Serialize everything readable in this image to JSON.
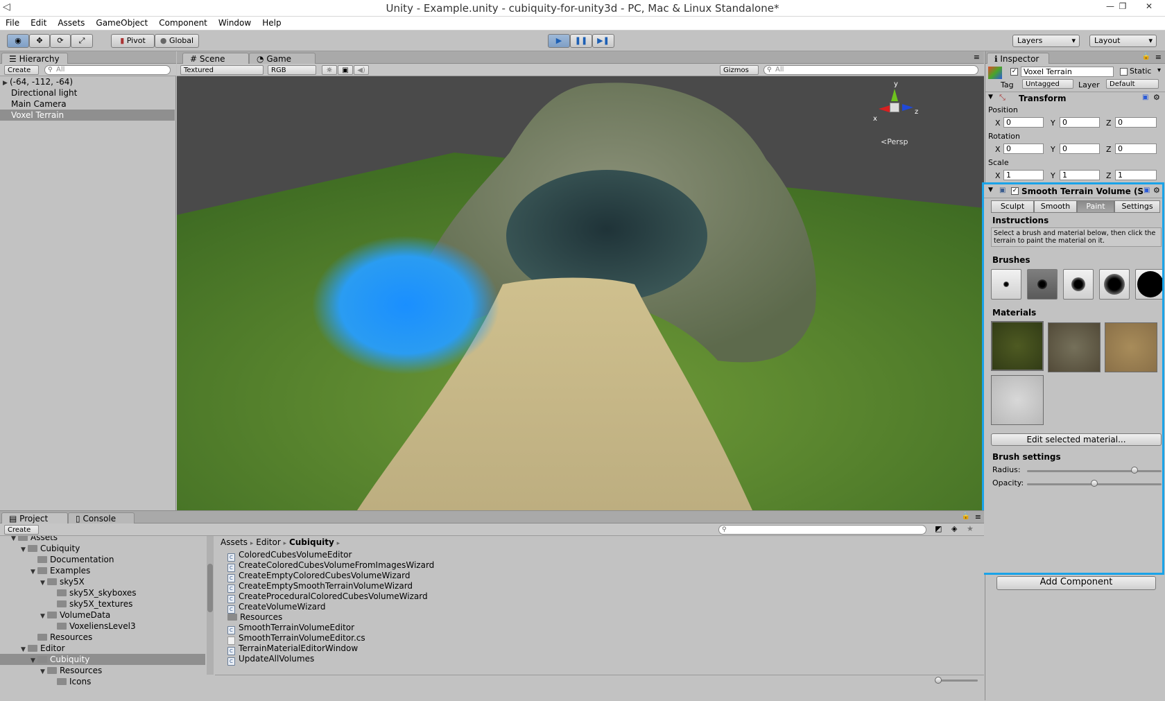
{
  "window": {
    "title": "Unity - Example.unity - cubiquity-for-unity3d - PC, Mac & Linux Standalone*"
  },
  "menu": [
    "File",
    "Edit",
    "Assets",
    "GameObject",
    "Component",
    "Window",
    "Help"
  ],
  "toolbar": {
    "pivot": "Pivot",
    "global": "Global",
    "layers": "Layers",
    "layout": "Layout"
  },
  "hierarchy": {
    "tab": "Hierarchy",
    "create": "Create",
    "search_placeholder": "All",
    "items": [
      "(-64, -112, -64)",
      "Directional light",
      "Main Camera",
      "Voxel Terrain"
    ]
  },
  "scene": {
    "tab_scene": "Scene",
    "tab_game": "Game",
    "render_mode": "Textured",
    "color_mode": "RGB",
    "gizmos": "Gizmos",
    "search_placeholder": "All",
    "persp": "Persp",
    "axis_y": "y",
    "axis_x": "x",
    "axis_z": "z"
  },
  "inspector": {
    "tab": "Inspector",
    "object_name": "Voxel Terrain",
    "static": "Static",
    "tag_label": "Tag",
    "tag_value": "Untagged",
    "layer_label": "Layer",
    "layer_value": "Default",
    "transform": {
      "title": "Transform",
      "position": {
        "label": "Position",
        "x": "0",
        "y": "0",
        "z": "0"
      },
      "rotation": {
        "label": "Rotation",
        "x": "0",
        "y": "0",
        "z": "0"
      },
      "scale": {
        "label": "Scale",
        "x": "1",
        "y": "1",
        "z": "1"
      },
      "x": "X",
      "y": "Y",
      "z": "Z"
    },
    "component": {
      "title": "Smooth Terrain Volume (S",
      "tabs": [
        "Sculpt",
        "Smooth",
        "Paint",
        "Settings"
      ],
      "instructions_title": "Instructions",
      "instructions_line1": "Select a brush and material below, then click the",
      "instructions_line2": "terrain to paint the material on it.",
      "brushes_title": "Brushes",
      "materials_title": "Materials",
      "edit_material": "Edit selected material...",
      "brush_settings_title": "Brush settings",
      "radius_label": "Radius:",
      "radius_value": 0.8,
      "opacity_label": "Opacity:",
      "opacity_value": 0.5
    },
    "add_component": "Add Component"
  },
  "project": {
    "tab_project": "Project",
    "tab_console": "Console",
    "create": "Create",
    "tree": [
      {
        "label": "Assets",
        "depth": 0
      },
      {
        "label": "Cubiquity",
        "depth": 1
      },
      {
        "label": "Documentation",
        "depth": 2
      },
      {
        "label": "Examples",
        "depth": 2
      },
      {
        "label": "sky5X",
        "depth": 3
      },
      {
        "label": "sky5X_skyboxes",
        "depth": 4
      },
      {
        "label": "sky5X_textures",
        "depth": 4
      },
      {
        "label": "VolumeData",
        "depth": 3
      },
      {
        "label": "VoxeliensLevel3",
        "depth": 4
      },
      {
        "label": "Resources",
        "depth": 2
      },
      {
        "label": "Editor",
        "depth": 1
      },
      {
        "label": "Cubiquity",
        "depth": 2
      },
      {
        "label": "Resources",
        "depth": 3
      },
      {
        "label": "Icons",
        "depth": 4
      }
    ],
    "breadcrumb": [
      "Assets",
      "Editor",
      "Cubiquity"
    ],
    "files": [
      {
        "label": "ColoredCubesVolumeEditor",
        "kind": "script"
      },
      {
        "label": "CreateColoredCubesVolumeFromImagesWizard",
        "kind": "script"
      },
      {
        "label": "CreateEmptyColoredCubesVolumeWizard",
        "kind": "script"
      },
      {
        "label": "CreateEmptySmoothTerrainVolumeWizard",
        "kind": "script"
      },
      {
        "label": "CreateProceduralColoredCubesVolumeWizard",
        "kind": "script"
      },
      {
        "label": "CreateVolumeWizard",
        "kind": "script"
      },
      {
        "label": "Resources",
        "kind": "folder"
      },
      {
        "label": "SmoothTerrainVolumeEditor",
        "kind": "script"
      },
      {
        "label": "SmoothTerrainVolumeEditor.cs",
        "kind": "file"
      },
      {
        "label": "TerrainMaterialEditorWindow",
        "kind": "script"
      },
      {
        "label": "UpdateAllVolumes",
        "kind": "script"
      }
    ]
  },
  "colors": {
    "highlight": "#1aa3e8",
    "selection": "#8f8f8f",
    "play_active": "#7f9fc6"
  }
}
